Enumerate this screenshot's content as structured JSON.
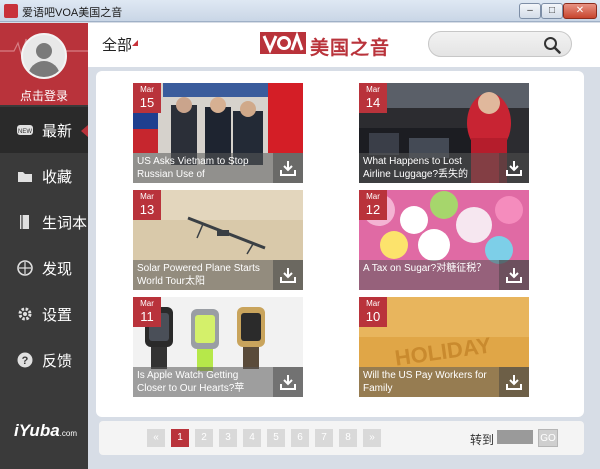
{
  "window": {
    "title": "爱语吧VOA美国之音",
    "minimize": "–",
    "maximize": "□",
    "close": "✕"
  },
  "sidebar": {
    "login_label": "点击登录",
    "items": [
      {
        "label": "最新",
        "icon": "new-icon",
        "active": true
      },
      {
        "label": "收藏",
        "icon": "folder-icon"
      },
      {
        "label": "生词本",
        "icon": "book-icon"
      },
      {
        "label": "发现",
        "icon": "compass-icon"
      },
      {
        "label": "设置",
        "icon": "gear-icon"
      },
      {
        "label": "反馈",
        "icon": "question-icon"
      }
    ],
    "brand": "iYuba",
    "brand_sub": ".com"
  },
  "header": {
    "category": "全部",
    "logo_mark": "VOA",
    "logo_text": "美国之音",
    "search_placeholder": ""
  },
  "articles": [
    {
      "month": "Mar",
      "day": "15",
      "title": "US Asks Vietnam to Stop Russian Use of"
    },
    {
      "month": "Mar",
      "day": "14",
      "title": "What Happens to Lost Airline Luggage?丢失的"
    },
    {
      "month": "Mar",
      "day": "13",
      "title": "Solar Powered Plane Starts World Tour太阳"
    },
    {
      "month": "Mar",
      "day": "12",
      "title": "A Tax on Sugar?对糖征税？"
    },
    {
      "month": "Mar",
      "day": "11",
      "title": "Is Apple Watch Getting Closer to Our Hearts?苹"
    },
    {
      "month": "Mar",
      "day": "10",
      "title": "Will the US Pay Workers for Family"
    }
  ],
  "pager": {
    "prev": "«",
    "pages": [
      "1",
      "2",
      "3",
      "4",
      "5",
      "6",
      "7",
      "8"
    ],
    "current": "1",
    "next": "»",
    "goto_label": "转到",
    "goto_button": "GO"
  },
  "colors": {
    "accent": "#b9333b",
    "sidebar": "#3a3a3a"
  }
}
